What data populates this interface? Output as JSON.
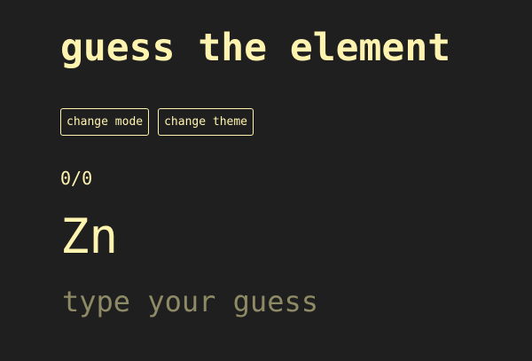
{
  "title": "guess the element",
  "buttons": {
    "change_mode": "change mode",
    "change_theme": "change theme"
  },
  "score": "0/0",
  "element_symbol": "Zn",
  "guess": {
    "placeholder": "type your guess",
    "value": ""
  },
  "colors": {
    "background": "#1f1f1f",
    "accent": "#fff3b0",
    "placeholder": "#8f8a66"
  }
}
